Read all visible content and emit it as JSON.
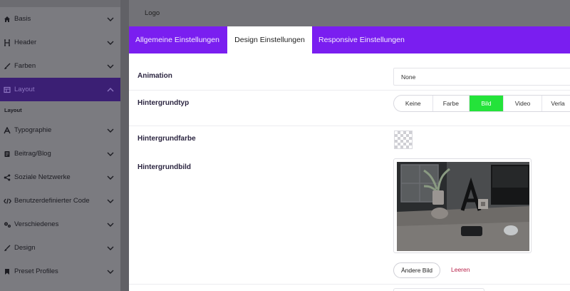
{
  "sidebar": {
    "items": [
      {
        "label": "Basis",
        "icon": "home-icon"
      },
      {
        "label": "Header",
        "icon": "heading-icon"
      },
      {
        "label": "Farben",
        "icon": "brush-icon"
      },
      {
        "label": "Layout",
        "icon": "layout-icon"
      },
      {
        "label": "Typographie",
        "icon": "font-icon"
      },
      {
        "label": "Beitrag/Blog",
        "icon": "document-icon"
      },
      {
        "label": "Soziale Netzwerke",
        "icon": "share-icon"
      },
      {
        "label": "Benutzerdefinierter Code",
        "icon": "code-icon"
      },
      {
        "label": "Verschiedenes",
        "icon": "gears-icon"
      },
      {
        "label": "Design",
        "icon": "brush-icon"
      },
      {
        "label": "Preset Profiles",
        "icon": "bookmark-icon"
      }
    ],
    "active_index": 3,
    "submenu_label": "Layout"
  },
  "topbar": {
    "logo": "Logo"
  },
  "tabs": [
    {
      "label": "Allgemeine Einstellungen"
    },
    {
      "label": "Design Einstellungen"
    },
    {
      "label": "Responsive Einstellungen"
    }
  ],
  "active_tab": 1,
  "fields": {
    "animation": {
      "label": "Animation",
      "value": "None"
    },
    "background_type": {
      "label": "Hintergrundtyp",
      "options": [
        "Keine",
        "Farbe",
        "Bild",
        "Video",
        "Verla"
      ],
      "selected": "Bild"
    },
    "background_color": {
      "label": "Hintergrundfarbe"
    },
    "background_image": {
      "label": "Hintergrundbild",
      "change_label": "Ändere Bild",
      "clear_label": "Leeren"
    }
  },
  "colors": {
    "accent": "#7a1ef0",
    "selected_option": "#24e33a",
    "active_sidebar": "#3b1f74",
    "clear_link": "#b8224a"
  }
}
